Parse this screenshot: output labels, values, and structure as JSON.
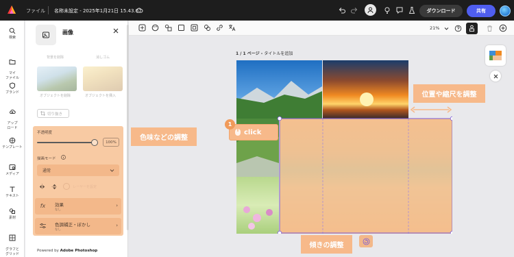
{
  "topbar": {
    "file_menu": "ファイル",
    "doc_title": "名称未設定 - 2025年1月21日 15.43.07",
    "download_label": "ダウンロード",
    "share_label": "共有"
  },
  "rail": {
    "items": [
      {
        "label": "検索",
        "icon": "search-icon"
      },
      {
        "label": "マイ\nファイル",
        "icon": "folder-icon"
      },
      {
        "label": "ブランド",
        "icon": "brand-icon"
      },
      {
        "label": "アップ\nロード",
        "icon": "upload-icon"
      },
      {
        "label": "テンプレート",
        "icon": "template-icon"
      },
      {
        "label": "メディア",
        "icon": "media-icon"
      },
      {
        "label": "テキスト",
        "icon": "text-icon"
      },
      {
        "label": "素材",
        "icon": "elements-icon"
      },
      {
        "label": "グラフと\nグリッド",
        "icon": "grid-icon"
      }
    ]
  },
  "panel": {
    "title": "画像",
    "ghost_left": "背景を削除",
    "ghost_right": "消しゴム",
    "thumb_left_caption": "オブジェクトを削除",
    "thumb_right_caption": "オブジェクトを挿入",
    "crop_label": "切り抜き",
    "opacity_label": "不透明度",
    "opacity_value": "100%",
    "blend_label": "描画モード",
    "blend_value": "通常",
    "ghost_flip": "レーヤーを設定",
    "effects_title": "効果",
    "effects_sub": "なし",
    "adjust_title": "色調補正・ぼかし",
    "adjust_sub": "なし",
    "powered_prefix": "Powered by ",
    "powered_brand": "Adobe Photoshop"
  },
  "toolbar": {
    "zoom": "21%"
  },
  "canvas": {
    "page_indicator": "1 / 1 ページ - ",
    "page_add_title": "タイトルを追加"
  },
  "callouts": {
    "color_adjust": "色味などの調整",
    "position_scale": "位置や縮尺を調整",
    "tilt_adjust": "傾きの調整",
    "click": "click",
    "step": "1"
  },
  "colors": {
    "accent_orange": "#f7b98a",
    "share_blue": "#4f5ef0",
    "selection": "#7a5cd6"
  }
}
